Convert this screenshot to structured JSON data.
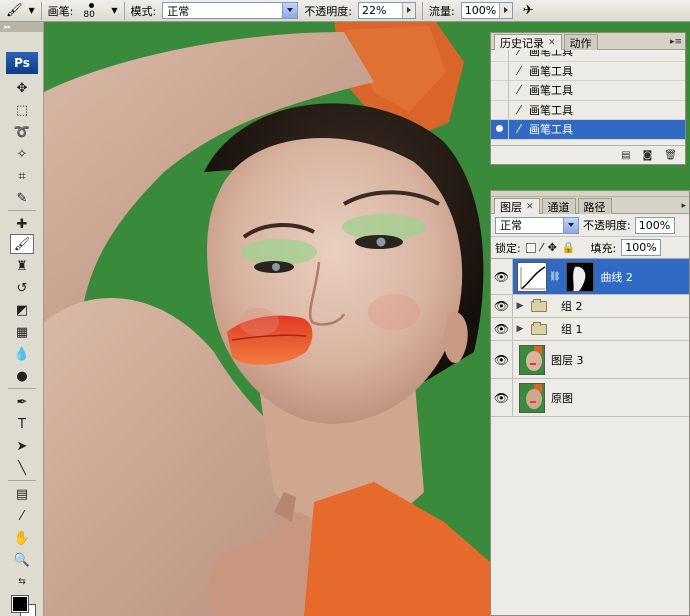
{
  "optbar": {
    "brush_label": "画笔:",
    "brush_size": "80",
    "mode_label": "模式:",
    "mode_value": "正常",
    "opacity_label": "不透明度:",
    "opacity_value": "22%",
    "flow_label": "流量:",
    "flow_value": "100%"
  },
  "toolbox": {
    "logo": "Ps",
    "grip": "▸▸",
    "foreground": "#000000",
    "background": "#ffffff"
  },
  "history_panel": {
    "tabs": [
      {
        "label": "历史记录",
        "active": true
      },
      {
        "label": "动作",
        "active": false
      }
    ],
    "items": [
      {
        "label": "画笔工具",
        "selected": false
      },
      {
        "label": "画笔工具",
        "selected": false
      },
      {
        "label": "画笔工具",
        "selected": false
      },
      {
        "label": "画笔工具",
        "selected": false
      },
      {
        "label": "画笔工具",
        "selected": true
      }
    ],
    "accent": "#316ac5"
  },
  "layers_panel": {
    "tabs": [
      {
        "label": "图层",
        "active": true
      },
      {
        "label": "通道",
        "active": false
      },
      {
        "label": "路径",
        "active": false
      }
    ],
    "blend_mode": "正常",
    "opacity_label": "不透明度:",
    "opacity_value": "100%",
    "lock_label": "锁定:",
    "fill_label": "填充:",
    "fill_value": "100%",
    "layers": [
      {
        "name": "曲线 2",
        "kind": "adjustment",
        "selected": true
      },
      {
        "name": "组 2",
        "kind": "group",
        "selected": false
      },
      {
        "name": "组 1",
        "kind": "group",
        "selected": false
      },
      {
        "name": "图层 3",
        "kind": "image",
        "selected": false
      },
      {
        "name": "原图",
        "kind": "image",
        "selected": false
      }
    ]
  },
  "colors": {
    "backdrop": "#3b8a3a",
    "selection": "#316ac5"
  }
}
